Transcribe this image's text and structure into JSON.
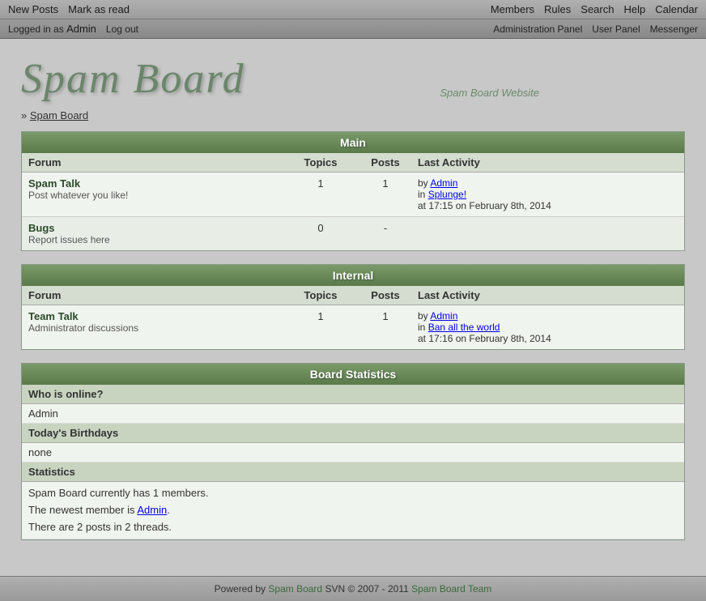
{
  "topnav": {
    "row1": {
      "left": [
        {
          "label": "New Posts",
          "name": "new-posts-link"
        },
        {
          "label": "Mark as read",
          "name": "mark-as-read-link"
        }
      ],
      "right": [
        {
          "label": "Members",
          "name": "members-link"
        },
        {
          "label": "Rules",
          "name": "rules-link"
        },
        {
          "label": "Search",
          "name": "search-link"
        },
        {
          "label": "Help",
          "name": "help-link"
        },
        {
          "label": "Calendar",
          "name": "calendar-link"
        }
      ]
    },
    "row2": {
      "left_text": "Logged in as ",
      "left_user": "Admin",
      "logout_label": "Log out",
      "right": [
        {
          "label": "Administration Panel",
          "name": "admin-panel-link"
        },
        {
          "label": "User Panel",
          "name": "user-panel-link"
        },
        {
          "label": "Messenger",
          "name": "messenger-link"
        }
      ]
    }
  },
  "logo": {
    "title": "Spam Board",
    "subtitle": "Spam Board Website"
  },
  "breadcrumb": {
    "separator": "»",
    "label": "Spam Board"
  },
  "main_section": {
    "header": "Main",
    "columns": [
      "Forum",
      "Topics",
      "Posts",
      "Last Activity"
    ],
    "forums": [
      {
        "name": "Spam Talk",
        "desc": "Post whatever you like!",
        "topics": "1",
        "posts": "1",
        "last_by": "Admin",
        "last_in": "Splunge!",
        "last_time": "at 17:15 on February 8th, 2014"
      },
      {
        "name": "Bugs",
        "desc": "Report issues here",
        "topics": "0",
        "posts": "-",
        "last_by": "",
        "last_in": "",
        "last_time": ""
      }
    ]
  },
  "internal_section": {
    "header": "Internal",
    "columns": [
      "Forum",
      "Topics",
      "Posts",
      "Last Activity"
    ],
    "forums": [
      {
        "name": "Team Talk",
        "desc": "Administrator discussions",
        "topics": "1",
        "posts": "1",
        "last_by": "Admin",
        "last_in": "Ban all the world",
        "last_time": "at 17:16 on February 8th, 2014"
      }
    ]
  },
  "board_stats": {
    "header": "Board Statistics",
    "who_online_header": "Who is online?",
    "who_online_value": "Admin",
    "birthdays_header": "Today's Birthdays",
    "birthdays_value": "none",
    "statistics_header": "Statistics",
    "statistics_lines": [
      "Spam Board currently has 1 members.",
      "The newest member is Admin.",
      "There are 2 posts in 2 threads."
    ]
  },
  "footer": {
    "powered_by": "Powered by",
    "brand": "Spam Board",
    "version": "SVN © 2007 - 2011",
    "team": "Spam Board Team"
  }
}
